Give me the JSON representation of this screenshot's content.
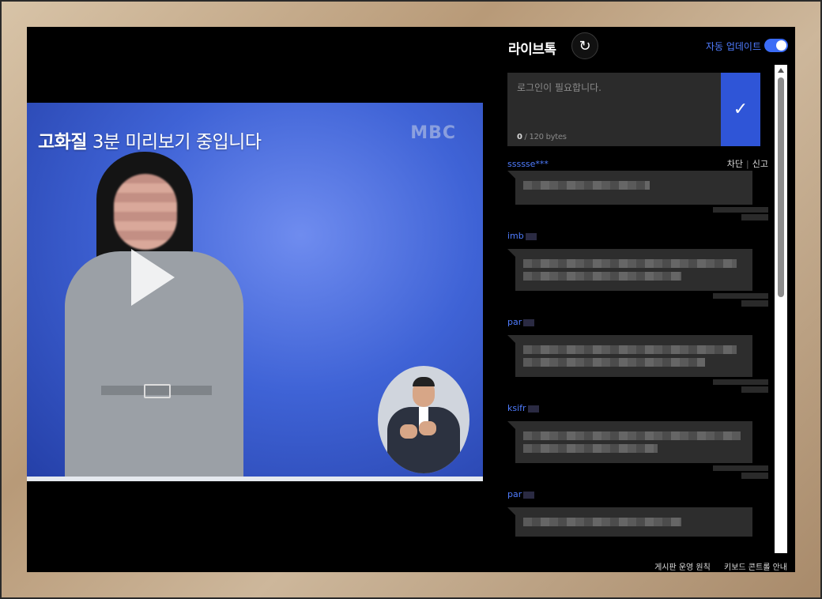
{
  "video": {
    "preview_bold": "고화질",
    "preview_rest": " 3분 미리보기 중입니다",
    "logo": "MBC"
  },
  "talk": {
    "title": "라이브톡",
    "auto_update_label": "자동 업데이트",
    "auto_update_on": true,
    "input_placeholder": "로그인이 필요합니다.",
    "bytes_used": "0",
    "bytes_limit": " / 120 bytes",
    "submit_icon": "check-icon",
    "block_label": "차단",
    "report_label": "신고",
    "comments": [
      {
        "user": "ssssse***"
      },
      {
        "user": "imb"
      },
      {
        "user": "par"
      },
      {
        "user": "ksifr"
      },
      {
        "user": "par"
      }
    ]
  },
  "footer": {
    "board_rules": "게시판 운영 원칙",
    "keyboard_guide": "키보드 콘트롤 안내"
  },
  "colors": {
    "accent": "#3b6cf6",
    "username": "#4f7cff",
    "panel_bg": "#000000"
  }
}
